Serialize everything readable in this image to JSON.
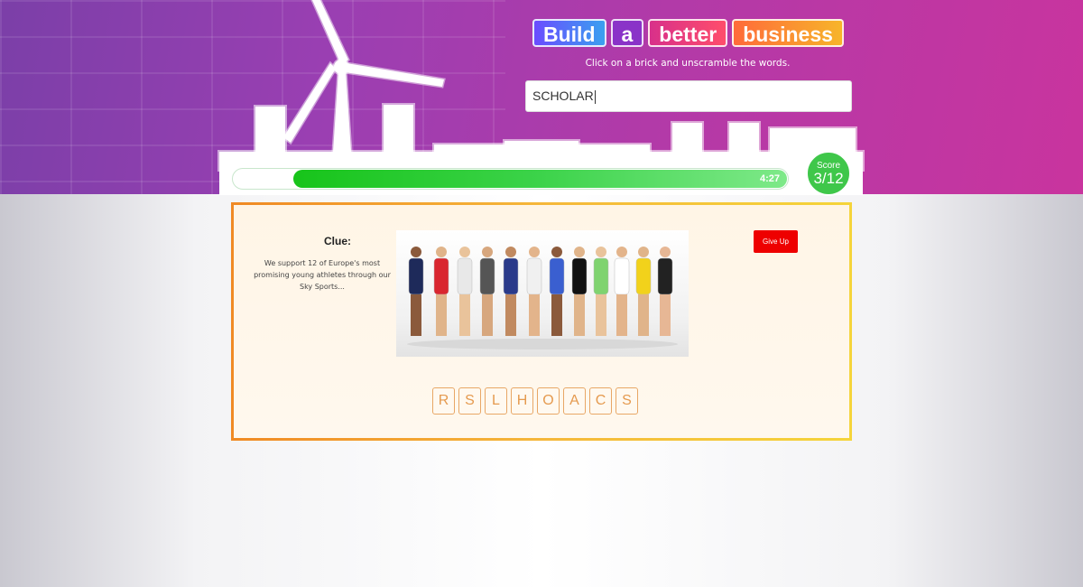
{
  "header": {
    "title_words": [
      "Build",
      "a",
      "better",
      "business"
    ],
    "instruction": "Click on a brick and unscramble the words.",
    "answer_value": "SCHOLAR"
  },
  "timer": {
    "time_left": "4:27",
    "fraction_remaining": 0.89
  },
  "score": {
    "label": "Score",
    "value": "3/12"
  },
  "clue": {
    "heading": "Clue:",
    "text": "We support 12 of Europe's most promising young athletes through our Sky Sports..."
  },
  "give_up_label": "Give Up",
  "letter_tiles": [
    "R",
    "S",
    "L",
    "H",
    "O",
    "A",
    "C",
    "S"
  ],
  "colors": {
    "accent_green": "#3fc74a",
    "give_up_red": "#ee0000",
    "card_border_orange": "#f08a24",
    "hero_purple": "#9a3fb2",
    "hero_magenta": "#c9349e"
  },
  "icons": {
    "turbine": "wind-turbine-icon"
  }
}
